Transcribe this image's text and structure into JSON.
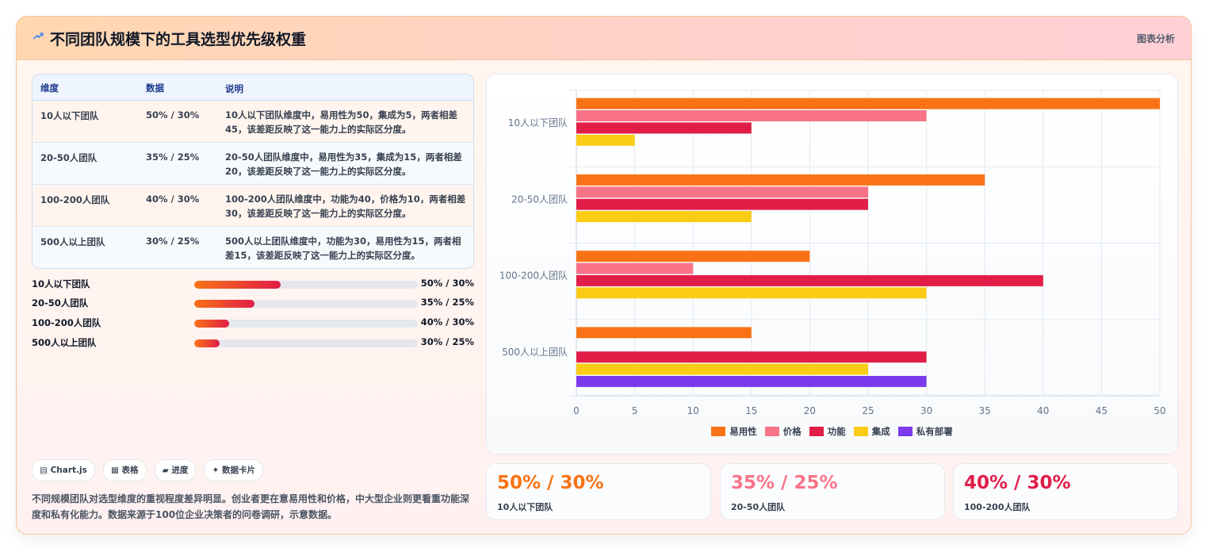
{
  "header": {
    "title": "不同团队规模下的工具选型优先级权重",
    "tag": "图表分析"
  },
  "table": {
    "headers": [
      "维度",
      "数据",
      "说明"
    ],
    "rows": [
      {
        "dim": "10人以下团队",
        "data": "50% / 30%",
        "desc": "10人以下团队维度中，易用性为50，集成为5，两者相差45，该差距反映了这一能力上的实际区分度。"
      },
      {
        "dim": "20-50人团队",
        "data": "35% / 25%",
        "desc": "20-50人团队维度中，易用性为35，集成为15，两者相差20，该差距反映了这一能力上的实际区分度。"
      },
      {
        "dim": "100-200人团队",
        "data": "40% / 30%",
        "desc": "100-200人团队维度中，功能为40，价格为10，两者相差30，该差距反映了这一能力上的实际区分度。"
      },
      {
        "dim": "500人以上团队",
        "data": "30% / 25%",
        "desc": "500人以上团队维度中，功能为30，易用性为15，两者相差15，该差距反映了这一能力上的实际区分度。"
      }
    ]
  },
  "progress": [
    {
      "label": "10人以下团队",
      "value": "50% / 30%",
      "fill": 0.385
    },
    {
      "label": "20-50人团队",
      "value": "35% / 25%",
      "fill": 0.27
    },
    {
      "label": "100-200人团队",
      "value": "40% / 30%",
      "fill": 0.155
    },
    {
      "label": "500人以上团队",
      "value": "30% / 25%",
      "fill": 0.115
    }
  ],
  "chips": [
    "▤ Chart.js",
    "▦ 表格",
    "▰ 进度",
    "✦ 数据卡片"
  ],
  "note": "不同规模团队对选型维度的重视程度差异明显。创业者更在意易用性和价格，中大型企业则更看重功能深度和私有化能力。数据来源于100位企业决策者的问卷调研，示意数据。",
  "colors": {
    "easy": "#f97316",
    "price": "#f87388",
    "func": "#e11d48",
    "integ": "#facc15",
    "priv": "#7c3aed"
  },
  "chart_data": {
    "type": "bar",
    "orientation": "horizontal",
    "categories": [
      "10人以下团队",
      "20-50人团队",
      "100-200人团队",
      "500人以上团队"
    ],
    "series": [
      {
        "name": "易用性",
        "color": "#f97316",
        "values": [
          50,
          35,
          20,
          15
        ]
      },
      {
        "name": "价格",
        "color": "#f87388",
        "values": [
          30,
          25,
          10,
          0
        ]
      },
      {
        "name": "功能",
        "color": "#e11d48",
        "values": [
          15,
          25,
          40,
          30
        ]
      },
      {
        "name": "集成",
        "color": "#facc15",
        "values": [
          5,
          15,
          30,
          25
        ]
      },
      {
        "name": "私有部署",
        "color": "#7c3aed",
        "values": [
          0,
          0,
          0,
          30
        ]
      }
    ],
    "xlim": [
      0,
      50
    ],
    "xticks": [
      0,
      5,
      10,
      15,
      20,
      25,
      30,
      35,
      40,
      45,
      50
    ],
    "grid": true,
    "legend": "bottom"
  },
  "stats": [
    {
      "value": "50% / 30%",
      "label": "10人以下团队",
      "color": "#f97316"
    },
    {
      "value": "35% / 25%",
      "label": "20-50人团队",
      "color": "#f87388"
    },
    {
      "value": "40% / 30%",
      "label": "100-200人团队",
      "color": "#e11d48"
    }
  ]
}
